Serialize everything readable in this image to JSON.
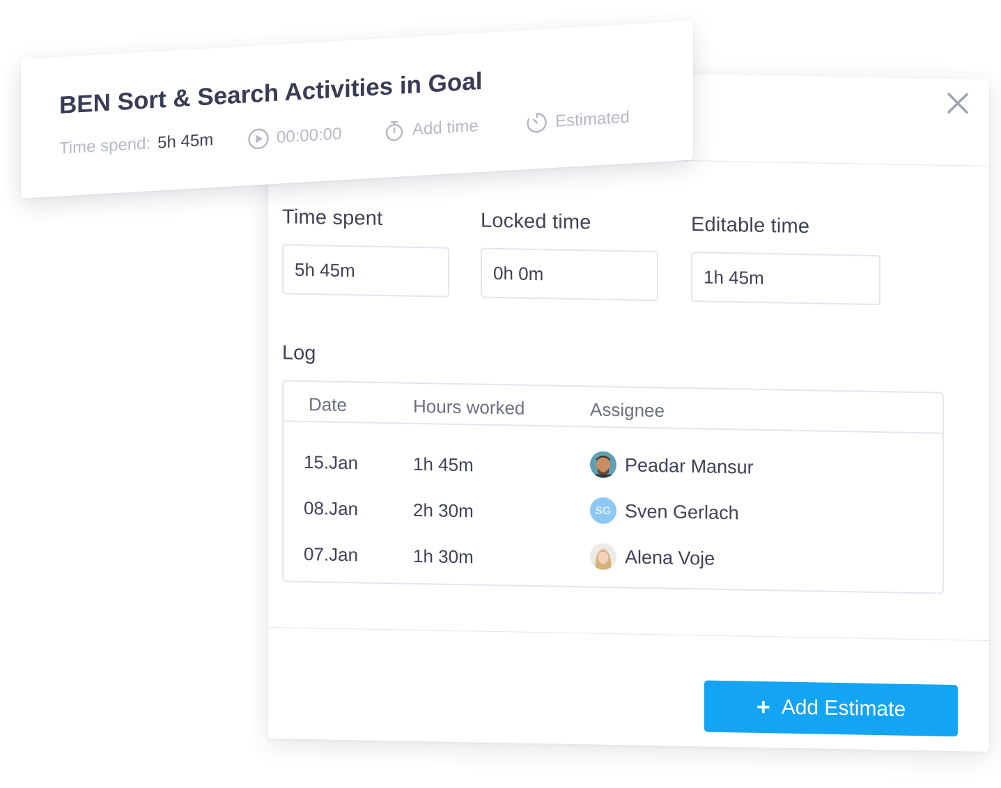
{
  "card": {
    "title": "BEN Sort & Search Activities in Goal",
    "time_spend_label": "Time spend:",
    "time_spend_value": "5h 45m",
    "timer_value": "00:00:00",
    "add_time_label": "Add time",
    "estimated_label": "Estimated"
  },
  "fields": {
    "time_spent": {
      "label": "Time spent",
      "value": "5h 45m"
    },
    "locked_time": {
      "label": "Locked time",
      "value": "0h 0m"
    },
    "editable_time": {
      "label": "Editable time",
      "value": "1h 45m"
    }
  },
  "log": {
    "title": "Log",
    "columns": [
      "Date",
      "Hours worked",
      "Assignee"
    ],
    "rows": [
      {
        "date": "15.Jan",
        "hours": "1h 45m",
        "assignee": "Peadar Mansur",
        "avatar": "photo"
      },
      {
        "date": "08.Jan",
        "hours": "2h 30m",
        "assignee": "Sven Gerlach",
        "avatar": "initials",
        "initials": "SG"
      },
      {
        "date": "07.Jan",
        "hours": "1h 30m",
        "assignee": "Alena Voje",
        "avatar": "photo"
      }
    ]
  },
  "actions": {
    "add_estimate_label": "Add Estimate"
  },
  "colors": {
    "primary": "#13a4f3",
    "text": "#3f4257",
    "muted": "#b5b9c7",
    "border": "#e3e6ee",
    "avatar_initials_bg": "#8cc8f2"
  },
  "icons": {
    "close": "close-icon",
    "play": "play-icon",
    "add_time": "stopwatch-icon",
    "estimated": "timer-icon",
    "plus": "plus-icon"
  }
}
